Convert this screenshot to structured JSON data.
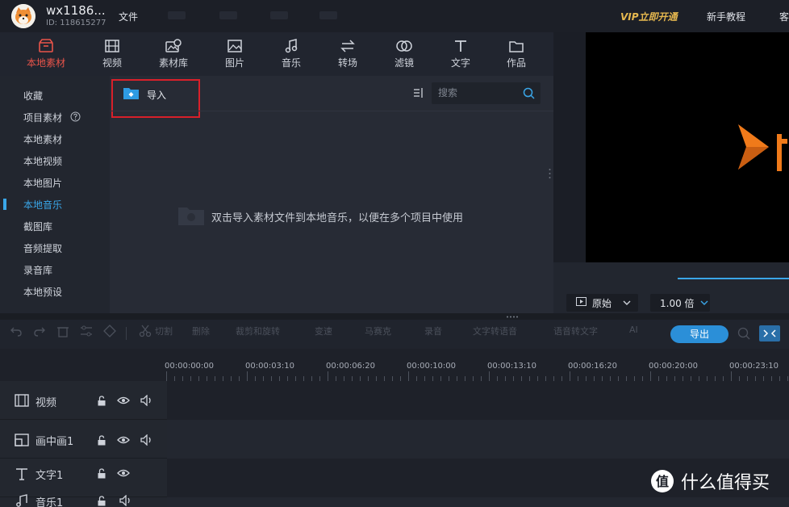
{
  "header": {
    "username": "wx1186...",
    "user_id": "ID: 118615277",
    "menu_file": "文件",
    "vip": "VIP立即开通",
    "tutorial": "新手教程",
    "more": "客"
  },
  "media_tools": [
    {
      "label": "本地素材",
      "icon": "box-icon",
      "active": true
    },
    {
      "label": "视频",
      "icon": "film-icon"
    },
    {
      "label": "素材库",
      "icon": "material-library-icon"
    },
    {
      "label": "图片",
      "icon": "image-icon"
    },
    {
      "label": "音乐",
      "icon": "music-icon"
    },
    {
      "label": "转场",
      "icon": "transition-icon"
    },
    {
      "label": "滤镜",
      "icon": "filter-icon"
    },
    {
      "label": "文字",
      "icon": "text-icon"
    },
    {
      "label": "作品",
      "icon": "folder-icon"
    }
  ],
  "sidebar": {
    "items": [
      {
        "label": "收藏"
      },
      {
        "label": "项目素材"
      },
      {
        "label": "本地素材"
      },
      {
        "label": "本地视频"
      },
      {
        "label": "本地图片"
      },
      {
        "label": "本地音乐",
        "active": true
      },
      {
        "label": "截图库"
      },
      {
        "label": "音频提取"
      },
      {
        "label": "录音库"
      },
      {
        "label": "本地预设"
      }
    ]
  },
  "media": {
    "import_label": "导入",
    "search_placeholder": "搜索",
    "empty_hint": "双击导入素材文件到本地音乐，以便在多个项目中使用"
  },
  "preview": {
    "ratio": "原始",
    "speed": "1.00 倍"
  },
  "edit_toolbar": {
    "items": [
      "切割",
      "删除",
      "裁剪和旋转",
      "变速",
      "马赛克",
      "录音",
      "文字转语音",
      "语音转文字",
      "AI"
    ],
    "export_label": "导出"
  },
  "timeline": {
    "timecodes": [
      "00:00:00:00",
      "00:00:03:10",
      "00:00:06:20",
      "00:00:10:00",
      "00:00:13:10",
      "00:00:16:20",
      "00:00:20:00",
      "00:00:23:10"
    ],
    "tracks": [
      {
        "name": "视频",
        "icon": "film-icon"
      },
      {
        "name": "画中画1",
        "icon": "pip-icon"
      },
      {
        "name": "文字1",
        "icon": "text-icon"
      },
      {
        "name": "音乐1",
        "icon": "music-icon"
      }
    ]
  },
  "watermark": {
    "text": "什么值得买",
    "logo": "值"
  }
}
